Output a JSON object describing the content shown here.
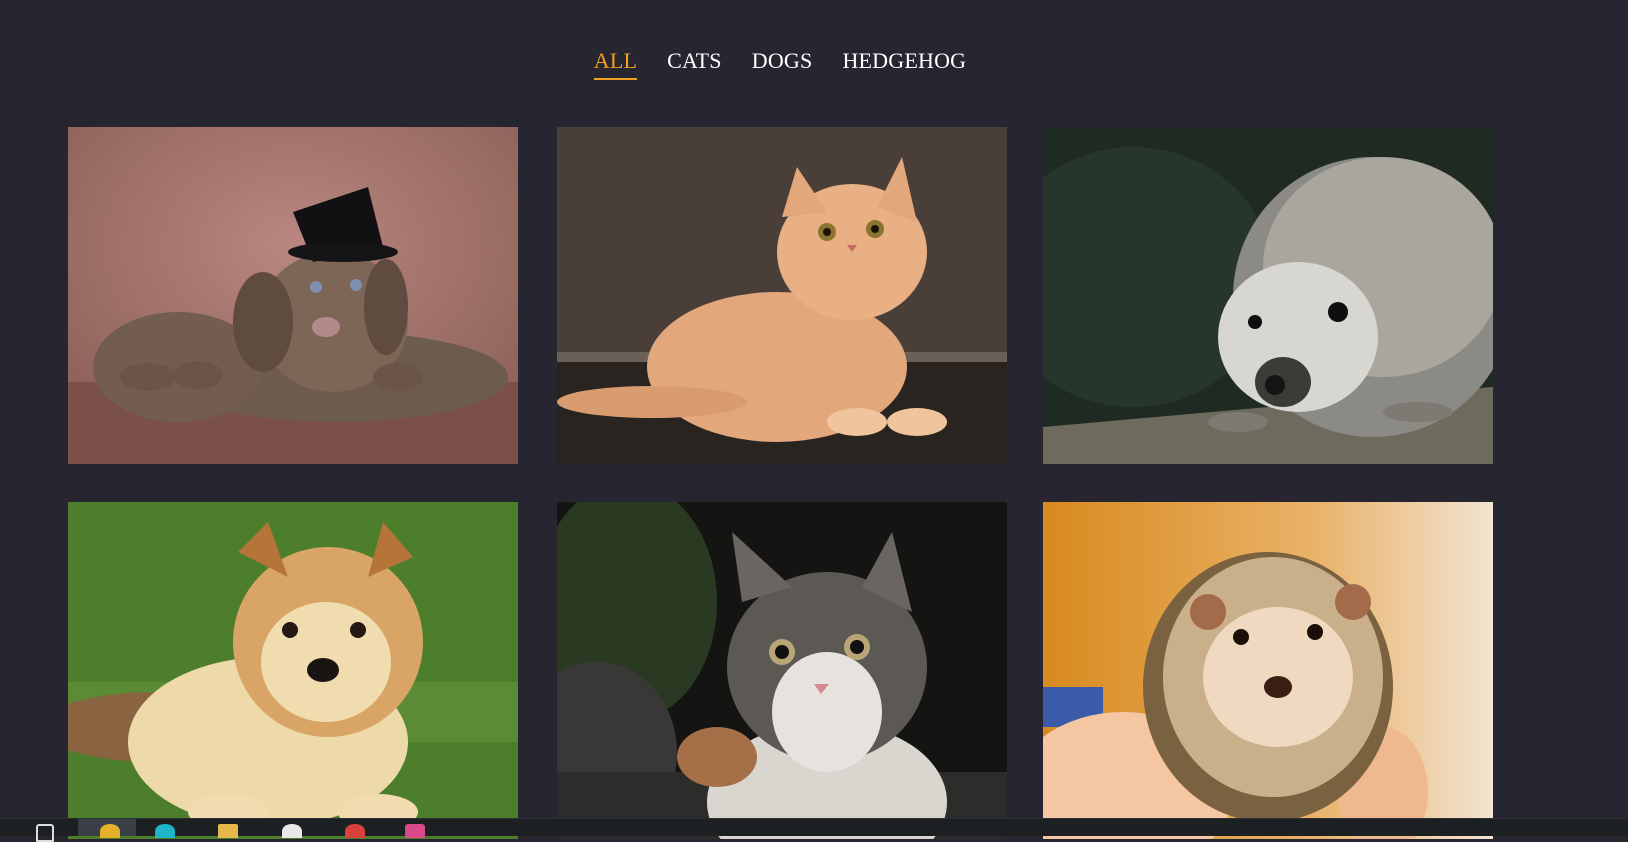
{
  "filters": {
    "items": [
      {
        "label": "ALL",
        "active": true
      },
      {
        "label": "CATS",
        "active": false
      },
      {
        "label": "DOGS",
        "active": false
      },
      {
        "label": "HEDGEHOG",
        "active": false
      }
    ]
  },
  "gallery": {
    "cards": [
      {
        "category": "DOGS",
        "icon": "puppy-with-top-hat"
      },
      {
        "category": "CATS",
        "icon": "ginger-kitten"
      },
      {
        "category": "HEDGEHOG",
        "icon": "hedgehog-on-wood"
      },
      {
        "category": "DOGS",
        "icon": "fluffy-puppy-on-grass"
      },
      {
        "category": "CATS",
        "icon": "tabby-kitten"
      },
      {
        "category": "HEDGEHOG",
        "icon": "hedgehog-in-hand"
      }
    ]
  },
  "colors": {
    "background": "#27252f",
    "accent": "#f0a020",
    "text": "#ffffff"
  }
}
